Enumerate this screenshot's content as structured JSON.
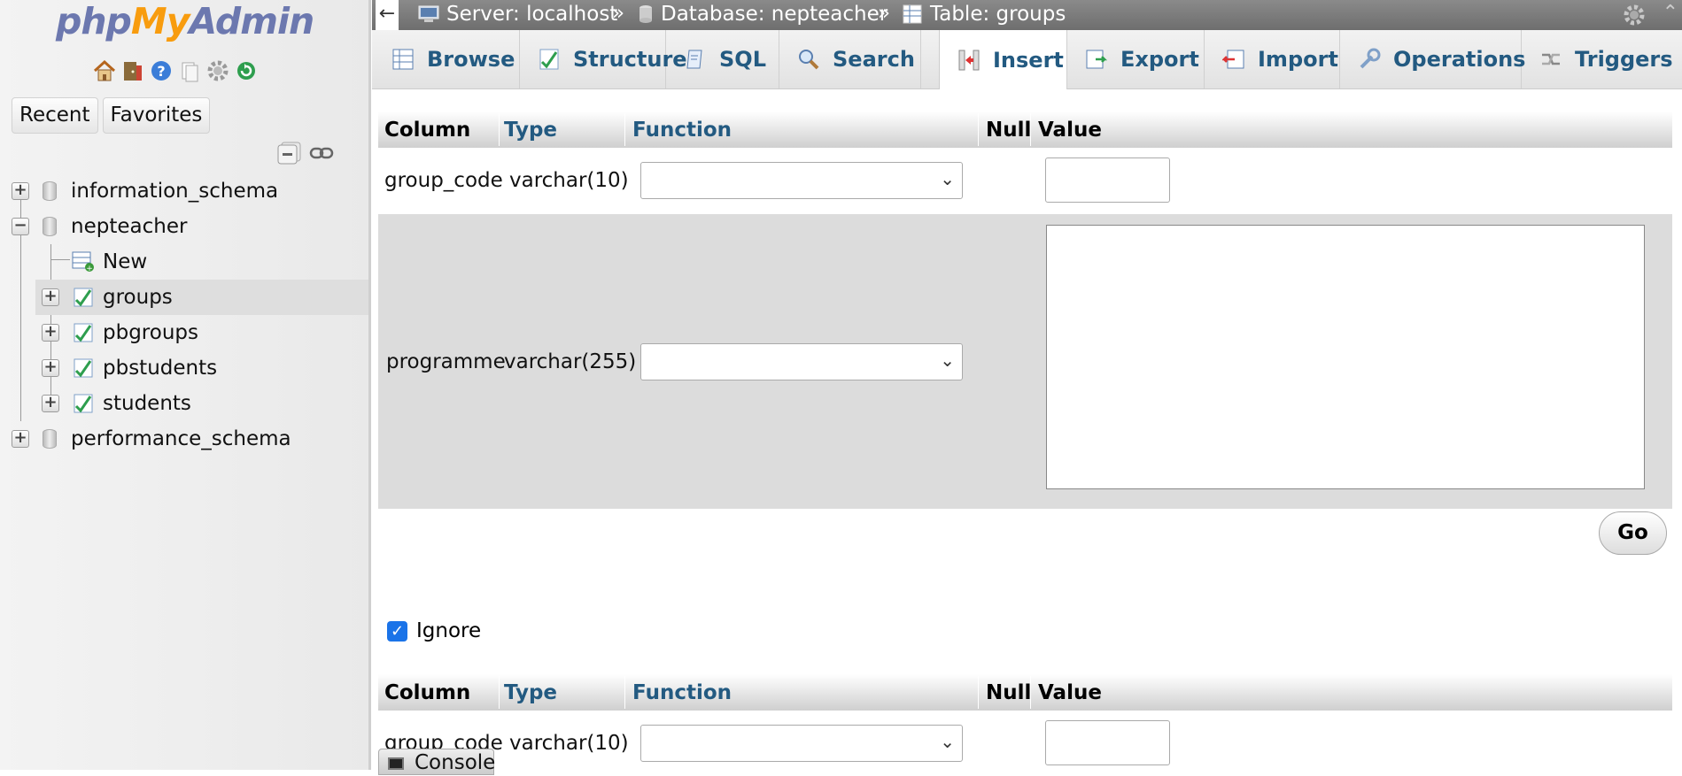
{
  "logo": {
    "php": "php",
    "my": "My",
    "admin": "Admin"
  },
  "nav": {
    "icons": [
      "home-icon",
      "exit-icon",
      "help-icon",
      "docs-icon",
      "settings-icon",
      "reload-icon"
    ],
    "recent_label": "Recent",
    "favorites_label": "Favorites",
    "tree": [
      {
        "label": "information_schema",
        "type": "db",
        "expanded": false
      },
      {
        "label": "nepteacher",
        "type": "db",
        "expanded": true
      },
      {
        "label": "New",
        "type": "new"
      },
      {
        "label": "groups",
        "type": "table",
        "selected": true
      },
      {
        "label": "pbgroups",
        "type": "table"
      },
      {
        "label": "pbstudents",
        "type": "table"
      },
      {
        "label": "students",
        "type": "table"
      },
      {
        "label": "performance_schema",
        "type": "db",
        "expanded": false
      }
    ]
  },
  "breadcrumb": {
    "server": "Server: localhost",
    "database": "Database: nepteacher",
    "table": "Table: groups",
    "separator": "»"
  },
  "tabs": [
    {
      "label": "Browse",
      "icon": "browse-icon"
    },
    {
      "label": "Structure",
      "icon": "structure-icon"
    },
    {
      "label": "SQL",
      "icon": "sql-icon"
    },
    {
      "label": "Search",
      "icon": "search-icon"
    },
    {
      "label": "Insert",
      "icon": "insert-icon",
      "active": true
    },
    {
      "label": "Export",
      "icon": "export-icon"
    },
    {
      "label": "Import",
      "icon": "import-icon"
    },
    {
      "label": "Operations",
      "icon": "operations-icon"
    },
    {
      "label": "Triggers",
      "icon": "triggers-icon"
    }
  ],
  "form": {
    "headers": {
      "column": "Column",
      "type": "Type",
      "function": "Function",
      "null": "Null",
      "value": "Value"
    },
    "rows": [
      {
        "column": "group_code",
        "type": "varchar(10)",
        "function": "",
        "value": ""
      },
      {
        "column": "programme",
        "type": "varchar(255)",
        "function": "",
        "value": ""
      }
    ],
    "go_label": "Go",
    "ignore_label": "Ignore",
    "ignore_checked": true,
    "rows2": [
      {
        "column": "group_code",
        "type": "varchar(10)",
        "function": "",
        "value": ""
      }
    ]
  },
  "console_label": "Console",
  "colors": {
    "link": "#235a81",
    "logo_blue": "#6c78af",
    "logo_orange": "#f89c0e",
    "checkbox": "#1a73e8"
  }
}
